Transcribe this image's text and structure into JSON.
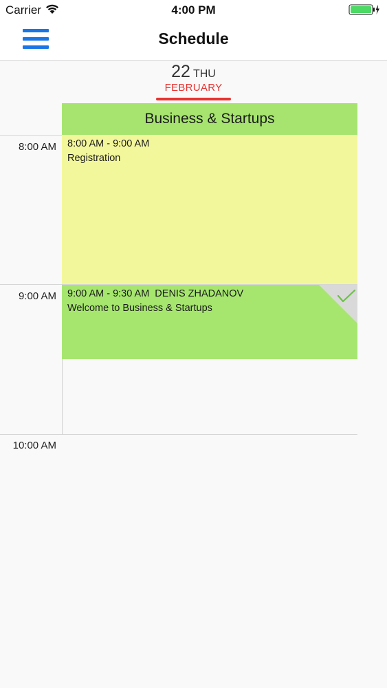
{
  "status_bar": {
    "carrier": "Carrier",
    "time": "4:00 PM",
    "wifi_icon": "wifi-icon",
    "battery_icon": "battery-charging-icon",
    "battery_color": "#4cd964"
  },
  "nav": {
    "title": "Schedule",
    "menu_icon": "hamburger-menu-icon",
    "menu_color": "#1976e6"
  },
  "date": {
    "day": "22",
    "weekday": "THU",
    "month": "FEBRUARY",
    "accent_color": "#e8322f"
  },
  "track": {
    "name": "Business & Startups",
    "color": "#a6e46f"
  },
  "time_labels": [
    "8:00 AM",
    "9:00 AM",
    "10:00 AM"
  ],
  "events": [
    {
      "time": "8:00 AM - 9:00 AM",
      "speaker": "",
      "title": "Registration",
      "color": "#f3f79b",
      "checked": false
    },
    {
      "time": "9:00 AM - 9:30 AM",
      "speaker": "DENIS ZHADANOV",
      "title": "Welcome to Business & Startups",
      "color": "#a6e66f",
      "checked": true,
      "check_icon": "checkmark-icon"
    }
  ]
}
